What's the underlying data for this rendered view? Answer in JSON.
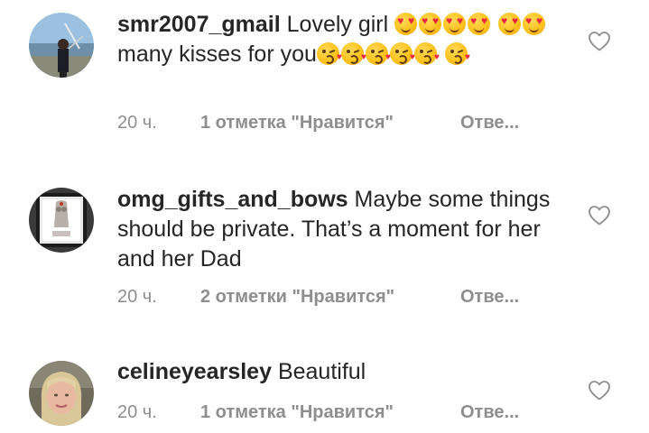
{
  "comments": [
    {
      "username": "smr2007_gmail",
      "text_1": "Lovely girl",
      "text_2": "many kisses for you",
      "time": "20 ч.",
      "likes": "1 отметка \"Нравится\"",
      "reply": "Отве..."
    },
    {
      "username": "omg_gifts_and_bows",
      "text": "Maybe some things should be private.  That’s a moment for her and her Dad",
      "time": "20 ч.",
      "likes": "2 отметки \"Нравится\"",
      "reply": "Отве..."
    },
    {
      "username": "celineyearsley",
      "text": "Beautiful",
      "time": "20 ч.",
      "likes": "1 отметка \"Нравится\"",
      "reply": "Отве..."
    }
  ],
  "icons": {
    "like": "heart-outline-icon",
    "emoji_heart_eyes": "heart-eyes-emoji",
    "emoji_kiss": "kissing-face-emoji"
  },
  "colors": {
    "text": "#262626",
    "meta": "#8e8e8e"
  }
}
